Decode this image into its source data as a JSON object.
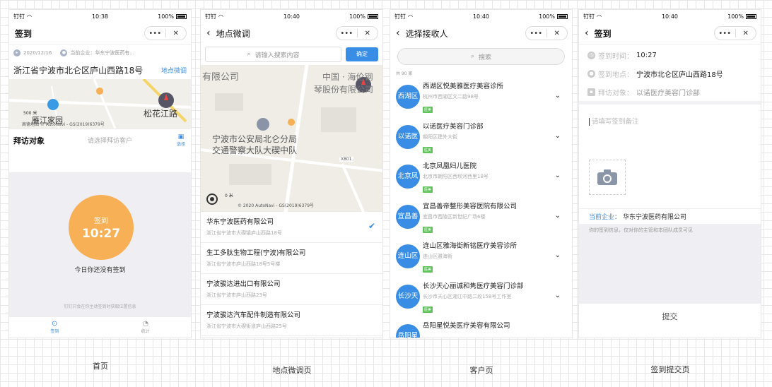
{
  "status_bar": {
    "carrier": "钉钉",
    "battery": "100%"
  },
  "screen1": {
    "time": "10:38",
    "title": "签到",
    "capsule_more": "•••",
    "capsule_close": "✕",
    "date": "2020/12/16",
    "enterprise": "当前企业：华东宁波医药有...",
    "address": "浙江省宁波市北仑区庐山西路18号",
    "adjust_link": "地点微调",
    "map": {
      "road": "松花江路",
      "place": "雁江家园",
      "scale": "500 米",
      "copyright": "高德地图 © AutoNavi - GS(2019)6379号"
    },
    "visit_label": "拜访对象",
    "visit_placeholder": "请选择拜访客户",
    "select_label": "选择",
    "sign_label": "签到",
    "sign_time": "10:27",
    "no_sign_text": "今日你还没有签到",
    "location_note": "钉钉只会在你主动签到时获取位置信息",
    "tabs": [
      {
        "label": "签到"
      },
      {
        "label": "统计"
      }
    ]
  },
  "screen2": {
    "time": "10:40",
    "title": "地点微调",
    "search_placeholder": "请输入搜索内容",
    "confirm": "确定",
    "map": {
      "label1": "有限公司",
      "label2": "中国 · 海伦钢",
      "label3": "琴股份有限公司",
      "label4": "宁波市公安局北仑分局",
      "label5": "交通警察大队大碶中队",
      "road": "X801",
      "scale": "0 米",
      "copyright": "© 2020 AutoNavi - GS(2019)6379号"
    },
    "companies": [
      {
        "name": "华东宁波医药有限公司",
        "address": "浙江省宁波市大碶镇庐山西路18号",
        "selected": true
      },
      {
        "name": "生工多肽生物工程(宁波)有限公司",
        "address": "浙江省宁波市庐山西路18号5号楼",
        "selected": false
      },
      {
        "name": "宁波骏达进出口有限公司",
        "address": "浙江省宁波市庐山西路23号",
        "selected": false
      },
      {
        "name": "宁波骏达汽车配件制造有限公司",
        "address": "浙江省宁波市大碶街道庐山西路25号",
        "selected": false
      }
    ]
  },
  "screen3": {
    "time": "10:40",
    "title": "选择接收人",
    "search_placeholder": "搜索",
    "count": "共 90 家",
    "customers": [
      {
        "avatar": "西湖区",
        "name": "西湖区悦美雅医疗美容诊所",
        "address": "杭州市西湖区文二路98号",
        "tag": "医美"
      },
      {
        "avatar": "以诺医",
        "name": "以诺医疗美容门诊部",
        "address": "朝阳区建外大街",
        "tag": "医美"
      },
      {
        "avatar": "北京凤",
        "name": "北京凤凰妇儿医院",
        "address": "北京市朝阳区西坝河西里18号",
        "tag": "医美"
      },
      {
        "avatar": "宜昌善",
        "name": "宜昌善帝整形美容医院有限公司",
        "address": "宜昌市西陵区新世纪广场6楼",
        "tag": "医美"
      },
      {
        "avatar": "连山区",
        "name": "连山区雅海街新铭医疗美容诊所",
        "address": "连山区雅海街",
        "tag": "医美"
      },
      {
        "avatar": "长沙天",
        "name": "长沙天心丽诚和隽医疗美容门诊部",
        "address": "长沙市天心区湘江中路二段158号工作室",
        "tag": "医美"
      },
      {
        "avatar": "岳阳星",
        "name": "岳阳星悦美医疗美容有限公司",
        "address": "",
        "tag": ""
      }
    ]
  },
  "screen4": {
    "time": "10:40",
    "title": "签到",
    "time_label": "签到时间：",
    "time_value": "10:27",
    "place_label": "签到地点：",
    "place_value": "宁波市北仑区庐山西路18号",
    "visit_label": "拜访对象：",
    "visit_value": "以诺医疗美容门诊部",
    "remark_placeholder": "请填写签到备注",
    "corp_label": "当前企业：",
    "corp_value": "华东宁波医药有限公司",
    "note": "你的签到信息，仅对你的主管和本团队成员可见",
    "submit": "提交"
  },
  "captions": [
    "首页",
    "地点微调页",
    "客户页",
    "签到提交页"
  ]
}
